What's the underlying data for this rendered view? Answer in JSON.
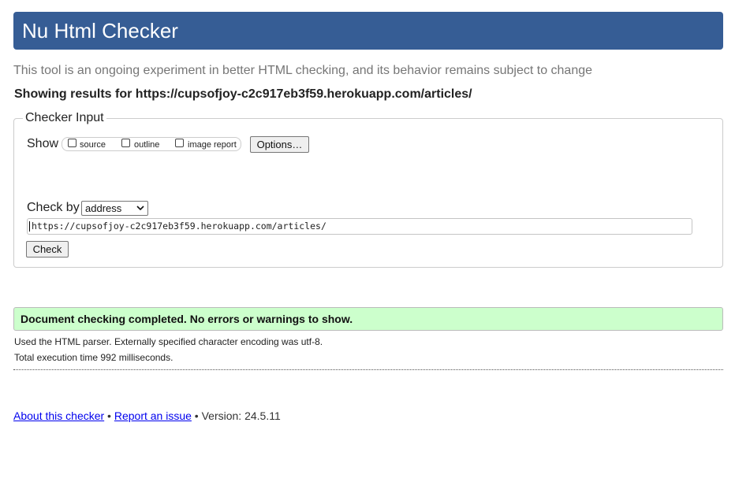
{
  "header": {
    "title": "Nu Html Checker",
    "background_color": "#365d95"
  },
  "intro_text": "This tool is an ongoing experiment in better HTML checking, and its behavior remains subject to change",
  "results_heading": "Showing results for https://cupsofjoy-c2c917eb3f59.herokuapp.com/articles/",
  "checker_input": {
    "legend": "Checker Input",
    "show_label": "Show",
    "options": [
      {
        "label": "source",
        "checked": false
      },
      {
        "label": "outline",
        "checked": false
      },
      {
        "label": "image report",
        "checked": false
      }
    ],
    "options_button": "Options…",
    "check_by_label": "Check by",
    "check_by_selected": "address",
    "url_value": "https://cupsofjoy-c2c917eb3f59.herokuapp.com/articles/",
    "check_button": "Check"
  },
  "result": {
    "message": "Document checking completed. No errors or warnings to show.",
    "background_color": "#ccffcc",
    "details": [
      "Used the HTML parser. Externally specified character encoding was utf-8.",
      "Total execution time 992 milliseconds."
    ]
  },
  "footer": {
    "about_link": "About this checker",
    "separator": " • ",
    "report_link": "Report an issue",
    "version_text": " • Version: 24.5.11",
    "link_color": "#0000ee"
  }
}
